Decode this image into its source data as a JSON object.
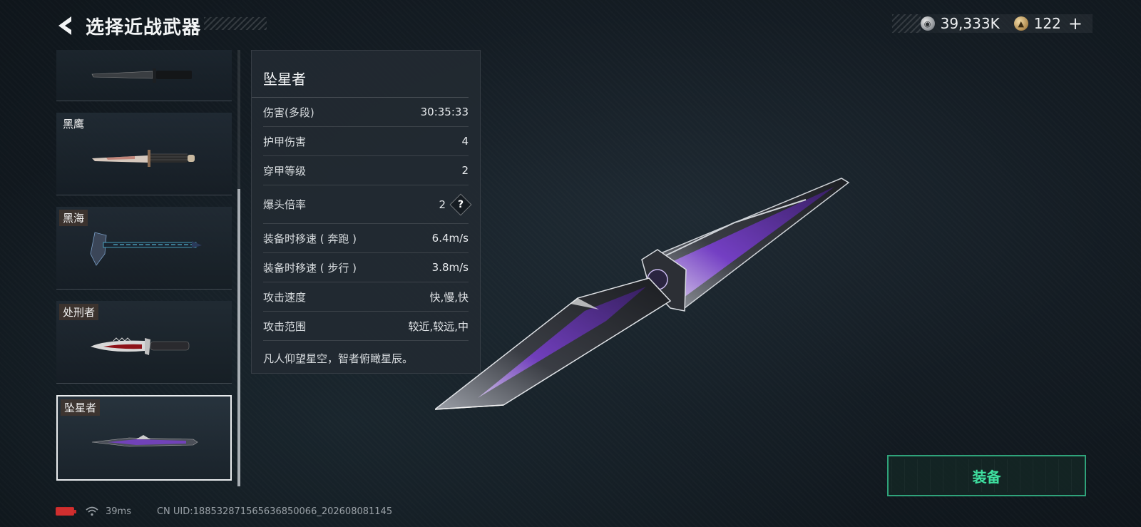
{
  "header": {
    "title": "选择近战武器",
    "back_icon": "chevron-left-icon"
  },
  "currency": {
    "silver_value": "39,333K",
    "gold_value": "122",
    "plus_label": "+"
  },
  "weapon_list": {
    "items": [
      {
        "name": "",
        "selected": false
      },
      {
        "name": "黑鹰",
        "selected": false
      },
      {
        "name": "黑海",
        "selected": false
      },
      {
        "name": "处刑者",
        "selected": false
      },
      {
        "name": "坠星者",
        "selected": true
      }
    ]
  },
  "stats": {
    "weapon_name": "坠星者",
    "rows": [
      {
        "label": "伤害(多段)",
        "value": "30:35:33"
      },
      {
        "label": "护甲伤害",
        "value": "4"
      },
      {
        "label": "穿甲等级",
        "value": "2"
      },
      {
        "label": "爆头倍率",
        "value": "2",
        "help_label": "?"
      },
      {
        "label": "装备时移速 ( 奔跑 )",
        "value": "6.4m/s"
      },
      {
        "label": "装备时移速 ( 步行 )",
        "value": "3.8m/s"
      },
      {
        "label": "攻击速度",
        "value": "快,慢,快"
      },
      {
        "label": "攻击范围",
        "value": "较近,较远,中"
      }
    ],
    "flavor_text": "凡人仰望星空，智者俯瞰星辰。"
  },
  "equip_button": {
    "label": "装备"
  },
  "footer": {
    "ping": "39ms",
    "uid": "CN UID:1885328715656368500​66_202608081145"
  },
  "colors": {
    "accent_green": "#3fe0a0",
    "equip_border": "#2fa37a",
    "battery_red": "#d02f2f",
    "weapon_purple": "#7a3fd1"
  }
}
